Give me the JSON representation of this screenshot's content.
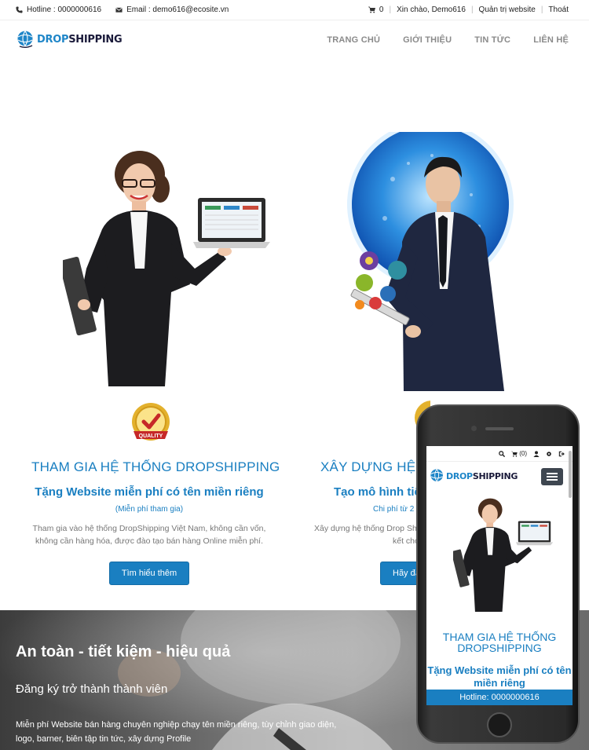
{
  "topbar": {
    "hotline": "Hotline : 0000000616",
    "email": "Email : demo616@ecosite.vn",
    "cart_count": "0",
    "greeting": "Xin chào, Demo616",
    "admin_link": "Quản trị website",
    "logout_link": "Thoát"
  },
  "logo": {
    "part1": "DROP",
    "part2": "SHIPPING"
  },
  "nav": {
    "home": "TRANG CHỦ",
    "about": "GIỚI THIỆU",
    "news": "TIN TỨC",
    "contact": "LIÊN HỆ"
  },
  "features": [
    {
      "title": "THAM GIA HỆ THỐNG DROPSHIPPING",
      "subtitle": "Tặng Website miễn phí có tên miền riêng",
      "note": "(Miễn phí tham gia)",
      "desc1": "Tham gia vào hệ thống DropShipping Việt Nam, không cần vốn,",
      "desc2": "không cần hàng hóa, được đào tạo bán hàng Online miễn phí.",
      "button": "Tìm hiểu thêm"
    },
    {
      "title": "XÂY DỰNG HỆ T",
      "subtitle": "Tạo mô hình tiế",
      "note": "Chi phí từ 2",
      "desc1": "Xây dựng hệ thống Drop Ship",
      "desc2": "kết cho bạn,",
      "button": "Hãy đăn"
    }
  ],
  "quality_badge": "QUALITY",
  "banner": {
    "title": "An toàn - tiết kiệm - hiệu quả",
    "subtitle": "Đăng ký trở thành thành viên",
    "text": "Miễn phí Website bán hàng chuyên nghiệp chạy tên miền riêng, tùy chỉnh giao diện, logo, barner, biên tập tin tức, xây dựng Profile"
  },
  "phone": {
    "cart": "(0)",
    "title": "THAM GIA HỆ THỐNG DROPSHIPPING",
    "subtitle": "Tặng Website miễn phí có tên miền riêng",
    "hotline": "Hotline: 0000000616"
  },
  "colors": {
    "accent": "#1a7fc1",
    "nav": "#8a8a8a",
    "dark_button": "#3e4650"
  }
}
